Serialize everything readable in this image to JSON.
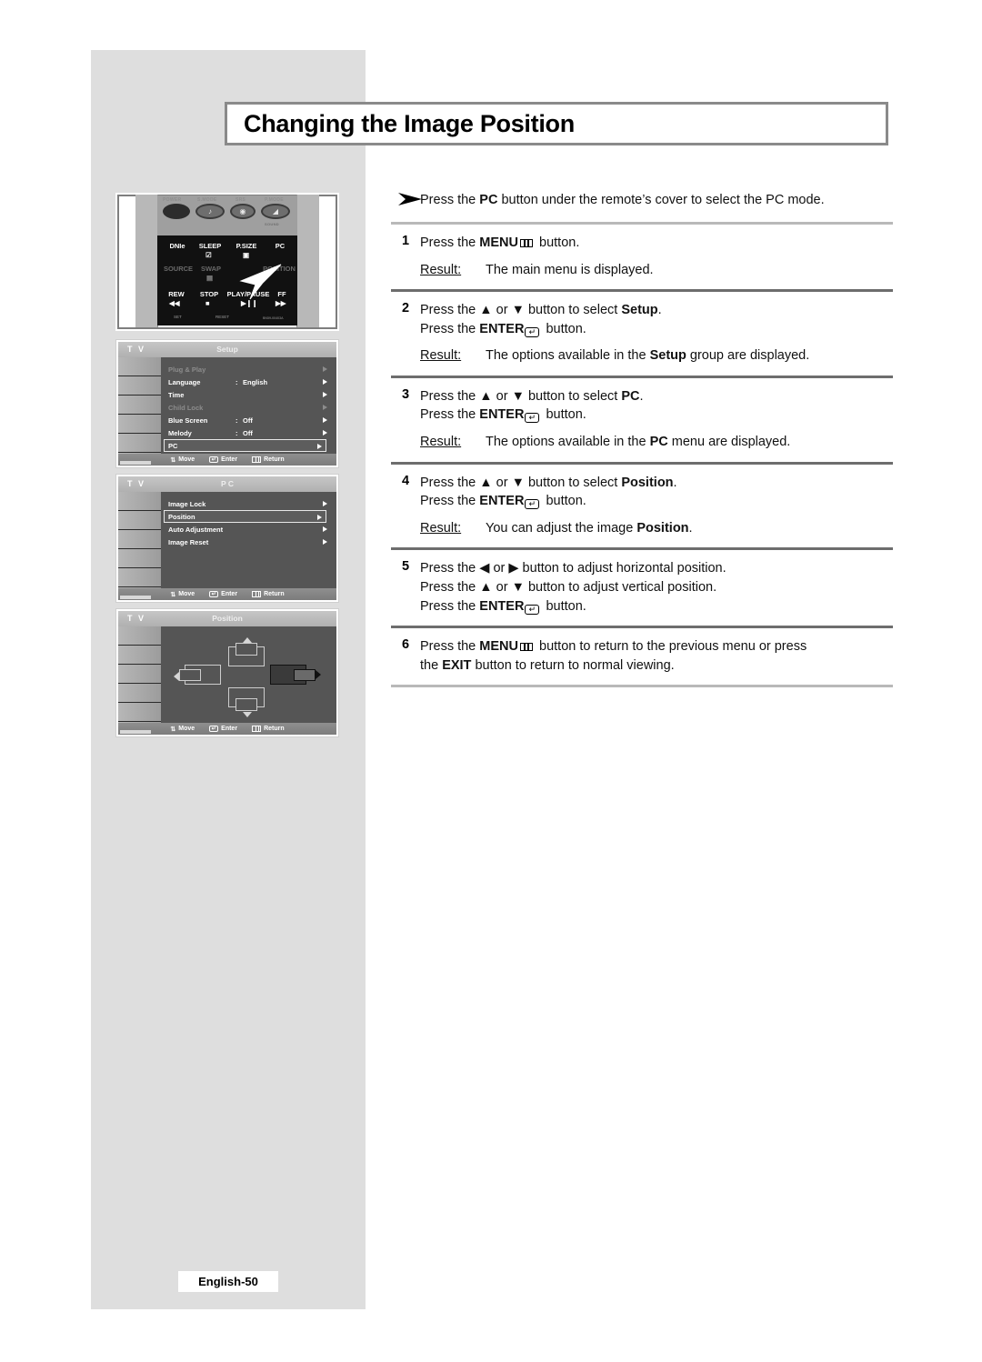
{
  "page": {
    "title": "Changing the Image Position",
    "footer": "English-50"
  },
  "intro": {
    "marker_icon": "arrowhead-icon",
    "text_before": "Press the ",
    "bold": "PC",
    "text_after": " button under the remote’s cover to select the PC mode."
  },
  "steps": [
    {
      "num": "1",
      "lines": [
        {
          "pre": "Press the ",
          "bold": "MENU",
          "glyph": "menu-icon",
          "post": " button."
        }
      ],
      "result_label": "Result:",
      "result": "The main menu is displayed."
    },
    {
      "num": "2",
      "lines": [
        {
          "pre": "Press the ▲ or ▼ button to select ",
          "bold": "Setup",
          "post": "."
        },
        {
          "pre": "Press the ",
          "bold": "ENTER",
          "glyph": "enter-icon",
          "post": " button."
        }
      ],
      "result_label": "Result:",
      "result_pre": "The options available in the ",
      "result_bold": "Setup",
      "result_post": " group are displayed."
    },
    {
      "num": "3",
      "lines": [
        {
          "pre": "Press the ▲ or ▼ button to select ",
          "bold": "PC",
          "post": "."
        },
        {
          "pre": "Press the ",
          "bold": "ENTER",
          "glyph": "enter-icon",
          "post": " button."
        }
      ],
      "result_label": "Result:",
      "result_pre": "The options available in the ",
      "result_bold": "PC",
      "result_post": " menu are displayed."
    },
    {
      "num": "4",
      "lines": [
        {
          "pre": "Press the ▲ or ▼ button to select ",
          "bold": "Position",
          "post": "."
        },
        {
          "pre": "Press the ",
          "bold": "ENTER",
          "glyph": "enter-icon",
          "post": " button."
        }
      ],
      "result_label": "Result:",
      "result_pre": "You can adjust the image ",
      "result_bold": "Position",
      "result_post": "."
    },
    {
      "num": "5",
      "lines": [
        {
          "pre": "Press the ◀ or ▶ button to adjust horizontal position.",
          "bold": "",
          "post": ""
        },
        {
          "pre": "Press the ▲ or ▼ button to adjust vertical position.",
          "bold": "",
          "post": ""
        },
        {
          "pre": "Press the ",
          "bold": "ENTER",
          "glyph": "enter-icon",
          "post": " button."
        }
      ]
    },
    {
      "num": "6",
      "lines": [
        {
          "pre": "Press the ",
          "bold": "MENU",
          "glyph": "menu-icon",
          "post": " button to return to the previous menu or press"
        },
        {
          "pre": "the ",
          "bold": "EXIT",
          "post": " button to return to normal viewing."
        }
      ]
    }
  ],
  "remote": {
    "top_labels": [
      "POWER",
      "S.MODE",
      "SRS",
      "P.MODE"
    ],
    "model_code": "BN59-00403A",
    "keys": {
      "r1": [
        "DNIe",
        "SLEEP",
        "P.SIZE",
        "PC"
      ],
      "r2": [
        "SOURCE",
        "SWAP",
        "POSITION"
      ],
      "r3": [
        "REW",
        "STOP",
        "PLAY/PAUSE",
        "FF"
      ],
      "r4": [
        "SET",
        "RESET"
      ]
    }
  },
  "osd": {
    "tv_label": "T V",
    "footer": {
      "move": "Move",
      "enter": "Enter",
      "return": "Return"
    },
    "setup": {
      "title": "Setup",
      "rows": [
        {
          "label": "Plug & Play",
          "value": "",
          "dim": true,
          "selected": false
        },
        {
          "label": "Language",
          "value": "English",
          "dim": false,
          "selected": false
        },
        {
          "label": "Time",
          "value": "",
          "dim": false,
          "selected": false
        },
        {
          "label": "Child Lock",
          "value": "",
          "dim": true,
          "selected": false
        },
        {
          "label": "Blue Screen",
          "value": "Off",
          "dim": false,
          "selected": false
        },
        {
          "label": "Melody",
          "value": "Off",
          "dim": false,
          "selected": false
        },
        {
          "label": "PC",
          "value": "",
          "dim": false,
          "selected": true
        }
      ]
    },
    "pc": {
      "title": "P C",
      "rows": [
        {
          "label": "Image Lock",
          "value": "",
          "dim": false,
          "selected": false
        },
        {
          "label": "Position",
          "value": "",
          "dim": false,
          "selected": true
        },
        {
          "label": "Auto Adjustment",
          "value": "",
          "dim": false,
          "selected": false
        },
        {
          "label": "Image Reset",
          "value": "",
          "dim": false,
          "selected": false
        }
      ]
    },
    "position": {
      "title": "Position",
      "handles": [
        "up-position-icon",
        "down-position-icon",
        "left-position-icon",
        "right-position-icon"
      ]
    }
  },
  "colors": {
    "page_panel": "#dedede",
    "rule": "#6d6d6d",
    "osd_body": "#555555",
    "osd_rail": "#a8a8a8",
    "title_border": "#8a8a8a"
  }
}
